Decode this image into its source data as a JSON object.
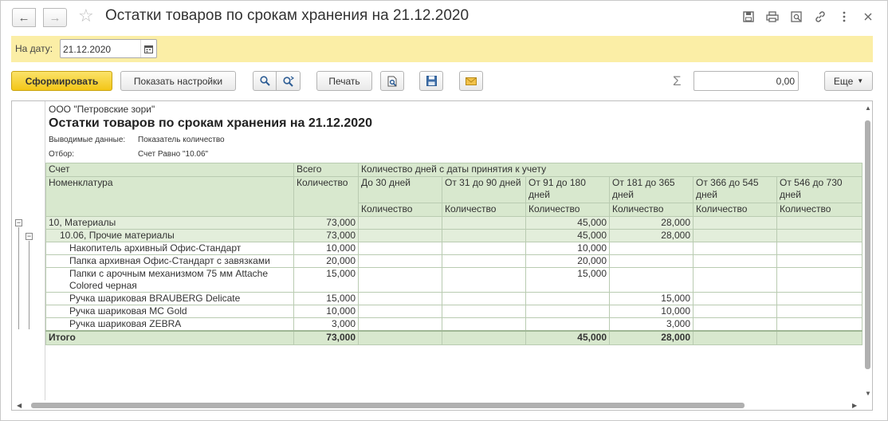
{
  "window": {
    "title": "Остатки товаров по срокам хранения на 21.12.2020"
  },
  "icons": {
    "back": "arrow-left-icon",
    "forward": "arrow-right-icon",
    "favorite": "star-icon",
    "save": "save-icon",
    "print": "print-icon",
    "preview": "preview-icon",
    "link": "link-icon",
    "more": "more-vertical-icon",
    "close": "close-icon"
  },
  "date_panel": {
    "label": "На дату:",
    "value": "21.12.2020"
  },
  "toolbar": {
    "generate": "Сформировать",
    "settings": "Показать настройки",
    "print": "Печать",
    "sum_value": "0,00",
    "more": "Еще"
  },
  "report": {
    "org": "ООО \"Петровские зори\"",
    "title": "Остатки товаров по срокам хранения на 21.12.2020",
    "output_label": "Выводимые данные:",
    "output_value": "Показатель количество",
    "filter_label": "Отбор:",
    "filter_value": "Счет Равно \"10.06\"",
    "headers": {
      "account": "Счет",
      "total": "Всего",
      "days": "Количество дней с даты принятия к учету",
      "item": "Номенклатура",
      "qty": "Количество",
      "periods": [
        "До 30 дней",
        "От 31 до 90 дней",
        "От 91 до 180 дней",
        "От 181 до 365 дней",
        "От 366 до 545 дней",
        "От 546 до 730 дней"
      ]
    },
    "rows": [
      {
        "name": "10, Материалы",
        "total": "73,000",
        "p": [
          "",
          "",
          "45,000",
          "28,000",
          "",
          ""
        ],
        "level": 0
      },
      {
        "name": "10.06, Прочие материалы",
        "total": "73,000",
        "p": [
          "",
          "",
          "45,000",
          "28,000",
          "",
          ""
        ],
        "level": 1
      },
      {
        "name": "Накопитель архивный Офис-Стандарт",
        "total": "10,000",
        "p": [
          "",
          "",
          "10,000",
          "",
          "",
          ""
        ],
        "level": 2
      },
      {
        "name": "Папка архивная Офис-Стандарт с завязками",
        "total": "20,000",
        "p": [
          "",
          "",
          "20,000",
          "",
          "",
          ""
        ],
        "level": 2
      },
      {
        "name": "Папки с арочным механизмом 75 мм Attache Colored черная",
        "total": "15,000",
        "p": [
          "",
          "",
          "15,000",
          "",
          "",
          ""
        ],
        "level": 2
      },
      {
        "name": "Ручка шариковая BRAUBERG Delicate",
        "total": "15,000",
        "p": [
          "",
          "",
          "",
          "15,000",
          "",
          ""
        ],
        "level": 2
      },
      {
        "name": "Ручка шариковая MC Gold",
        "total": "10,000",
        "p": [
          "",
          "",
          "",
          "10,000",
          "",
          ""
        ],
        "level": 2
      },
      {
        "name": "Ручка шариковая ZEBRA",
        "total": "3,000",
        "p": [
          "",
          "",
          "",
          "3,000",
          "",
          ""
        ],
        "level": 2
      }
    ],
    "total_row": {
      "name": "Итого",
      "total": "73,000",
      "p": [
        "",
        "",
        "45,000",
        "28,000",
        "",
        ""
      ]
    }
  }
}
